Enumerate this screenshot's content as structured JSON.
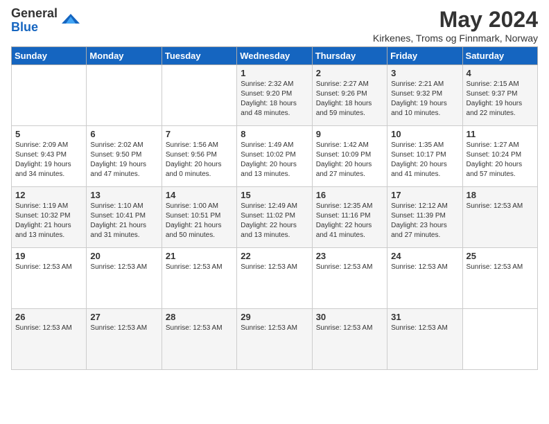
{
  "logo": {
    "general": "General",
    "blue": "Blue"
  },
  "title": {
    "month_year": "May 2024",
    "location": "Kirkenes, Troms og Finnmark, Norway"
  },
  "days_of_week": [
    "Sunday",
    "Monday",
    "Tuesday",
    "Wednesday",
    "Thursday",
    "Friday",
    "Saturday"
  ],
  "weeks": [
    [
      {
        "day": "",
        "info": ""
      },
      {
        "day": "",
        "info": ""
      },
      {
        "day": "",
        "info": ""
      },
      {
        "day": "1",
        "info": "Sunrise: 2:32 AM\nSunset: 9:20 PM\nDaylight: 18 hours and 48 minutes."
      },
      {
        "day": "2",
        "info": "Sunrise: 2:27 AM\nSunset: 9:26 PM\nDaylight: 18 hours and 59 minutes."
      },
      {
        "day": "3",
        "info": "Sunrise: 2:21 AM\nSunset: 9:32 PM\nDaylight: 19 hours and 10 minutes."
      },
      {
        "day": "4",
        "info": "Sunrise: 2:15 AM\nSunset: 9:37 PM\nDaylight: 19 hours and 22 minutes."
      }
    ],
    [
      {
        "day": "5",
        "info": "Sunrise: 2:09 AM\nSunset: 9:43 PM\nDaylight: 19 hours and 34 minutes."
      },
      {
        "day": "6",
        "info": "Sunrise: 2:02 AM\nSunset: 9:50 PM\nDaylight: 19 hours and 47 minutes."
      },
      {
        "day": "7",
        "info": "Sunrise: 1:56 AM\nSunset: 9:56 PM\nDaylight: 20 hours and 0 minutes."
      },
      {
        "day": "8",
        "info": "Sunrise: 1:49 AM\nSunset: 10:02 PM\nDaylight: 20 hours and 13 minutes."
      },
      {
        "day": "9",
        "info": "Sunrise: 1:42 AM\nSunset: 10:09 PM\nDaylight: 20 hours and 27 minutes."
      },
      {
        "day": "10",
        "info": "Sunrise: 1:35 AM\nSunset: 10:17 PM\nDaylight: 20 hours and 41 minutes."
      },
      {
        "day": "11",
        "info": "Sunrise: 1:27 AM\nSunset: 10:24 PM\nDaylight: 20 hours and 57 minutes."
      }
    ],
    [
      {
        "day": "12",
        "info": "Sunrise: 1:19 AM\nSunset: 10:32 PM\nDaylight: 21 hours and 13 minutes."
      },
      {
        "day": "13",
        "info": "Sunrise: 1:10 AM\nSunset: 10:41 PM\nDaylight: 21 hours and 31 minutes."
      },
      {
        "day": "14",
        "info": "Sunrise: 1:00 AM\nSunset: 10:51 PM\nDaylight: 21 hours and 50 minutes."
      },
      {
        "day": "15",
        "info": "Sunrise: 12:49 AM\nSunset: 11:02 PM\nDaylight: 22 hours and 13 minutes."
      },
      {
        "day": "16",
        "info": "Sunrise: 12:35 AM\nSunset: 11:16 PM\nDaylight: 22 hours and 41 minutes."
      },
      {
        "day": "17",
        "info": "Sunrise: 12:12 AM\nSunset: 11:39 PM\nDaylight: 23 hours and 27 minutes."
      },
      {
        "day": "18",
        "info": "Sunrise: 12:53 AM"
      }
    ],
    [
      {
        "day": "19",
        "info": "Sunrise: 12:53 AM"
      },
      {
        "day": "20",
        "info": "Sunrise: 12:53 AM"
      },
      {
        "day": "21",
        "info": "Sunrise: 12:53 AM"
      },
      {
        "day": "22",
        "info": "Sunrise: 12:53 AM"
      },
      {
        "day": "23",
        "info": "Sunrise: 12:53 AM"
      },
      {
        "day": "24",
        "info": "Sunrise: 12:53 AM"
      },
      {
        "day": "25",
        "info": "Sunrise: 12:53 AM"
      }
    ],
    [
      {
        "day": "26",
        "info": "Sunrise: 12:53 AM"
      },
      {
        "day": "27",
        "info": "Sunrise: 12:53 AM"
      },
      {
        "day": "28",
        "info": "Sunrise: 12:53 AM"
      },
      {
        "day": "29",
        "info": "Sunrise: 12:53 AM"
      },
      {
        "day": "30",
        "info": "Sunrise: 12:53 AM"
      },
      {
        "day": "31",
        "info": "Sunrise: 12:53 AM"
      },
      {
        "day": "",
        "info": ""
      }
    ]
  ]
}
